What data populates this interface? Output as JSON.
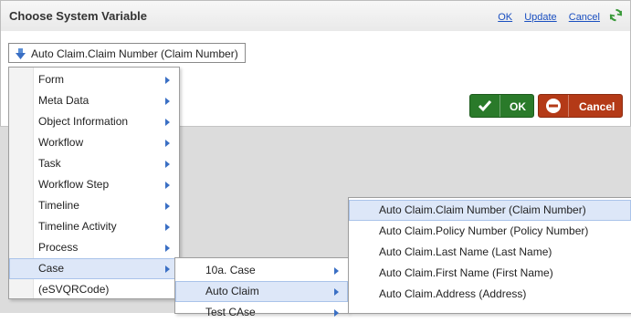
{
  "dialog": {
    "title": "Choose System Variable",
    "links": {
      "ok": "OK",
      "update": "Update",
      "cancel": "Cancel"
    },
    "icons": {
      "refresh": "refresh-icon",
      "arrow": "down-arrow-icon",
      "check": "check-icon",
      "minus": "minus-circle-icon"
    }
  },
  "selector": {
    "value": "Auto Claim.Claim Number (Claim Number)"
  },
  "buttons": {
    "ok_label": "OK",
    "cancel_label": "Cancel"
  },
  "menu_level1": [
    {
      "label": "Form",
      "submenu": true
    },
    {
      "label": "Meta Data",
      "submenu": true
    },
    {
      "label": "Object Information",
      "submenu": true
    },
    {
      "label": "Workflow",
      "submenu": true
    },
    {
      "label": "Task",
      "submenu": true
    },
    {
      "label": "Workflow Step",
      "submenu": true
    },
    {
      "label": "Timeline",
      "submenu": true
    },
    {
      "label": "Timeline Activity",
      "submenu": true
    },
    {
      "label": "Process",
      "submenu": true
    },
    {
      "label": "Case",
      "submenu": true,
      "highlighted": true
    },
    {
      "label": "(eSVQRCode)",
      "submenu": false
    }
  ],
  "menu_level2": [
    {
      "label": "10a. Case",
      "submenu": true
    },
    {
      "label": "Auto Claim",
      "submenu": true,
      "highlighted": true
    },
    {
      "label": "Test CAse",
      "submenu": true
    }
  ],
  "menu_level3": [
    {
      "label": "Auto Claim.Claim Number (Claim Number)",
      "highlighted": true
    },
    {
      "label": "Auto Claim.Policy Number (Policy Number)"
    },
    {
      "label": "Auto Claim.Last Name (Last Name)"
    },
    {
      "label": "Auto Claim.First Name (First Name)"
    },
    {
      "label": "Auto Claim.Address (Address)"
    }
  ],
  "colors": {
    "link": "#1a4fc0",
    "ok_button": "#2a7a2a",
    "cancel_button": "#b43a17",
    "highlight": "#dde7f8",
    "chevron": "#3a6fc4"
  }
}
